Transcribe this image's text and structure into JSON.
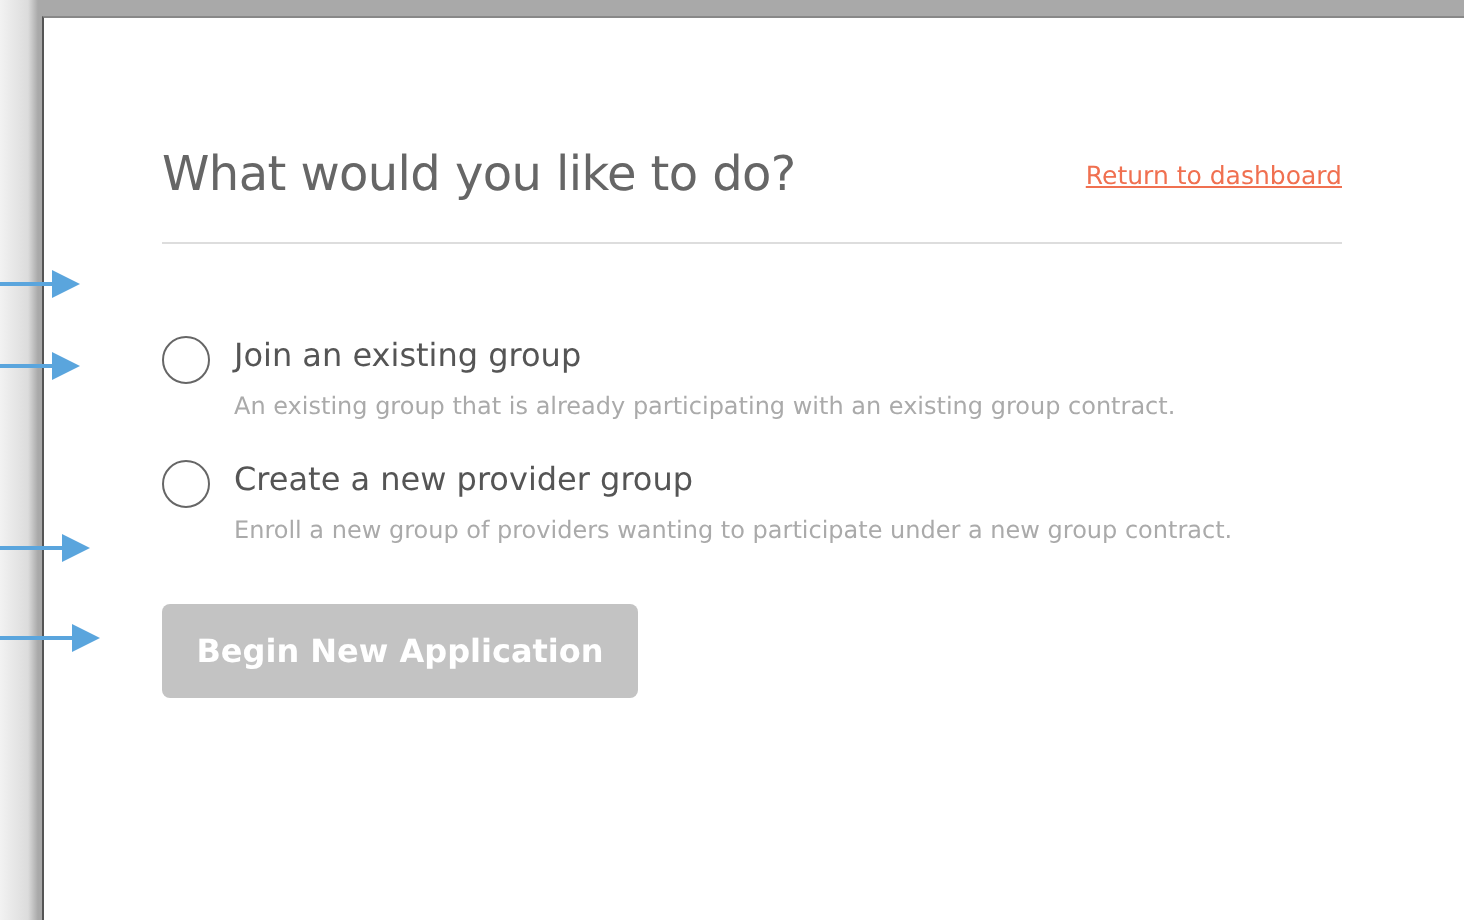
{
  "heading": "What would you like to do?",
  "return_link": "Return to dashboard",
  "options": [
    {
      "label": "Join an existing group",
      "description": "An existing group that is already participating with an existing group contract.",
      "selected": false
    },
    {
      "label": "Create a new provider group",
      "description": "Enroll a new group of providers wanting to participate under a new group contract.",
      "selected": false
    }
  ],
  "begin_button": {
    "label": "Begin New Application",
    "disabled": true
  }
}
